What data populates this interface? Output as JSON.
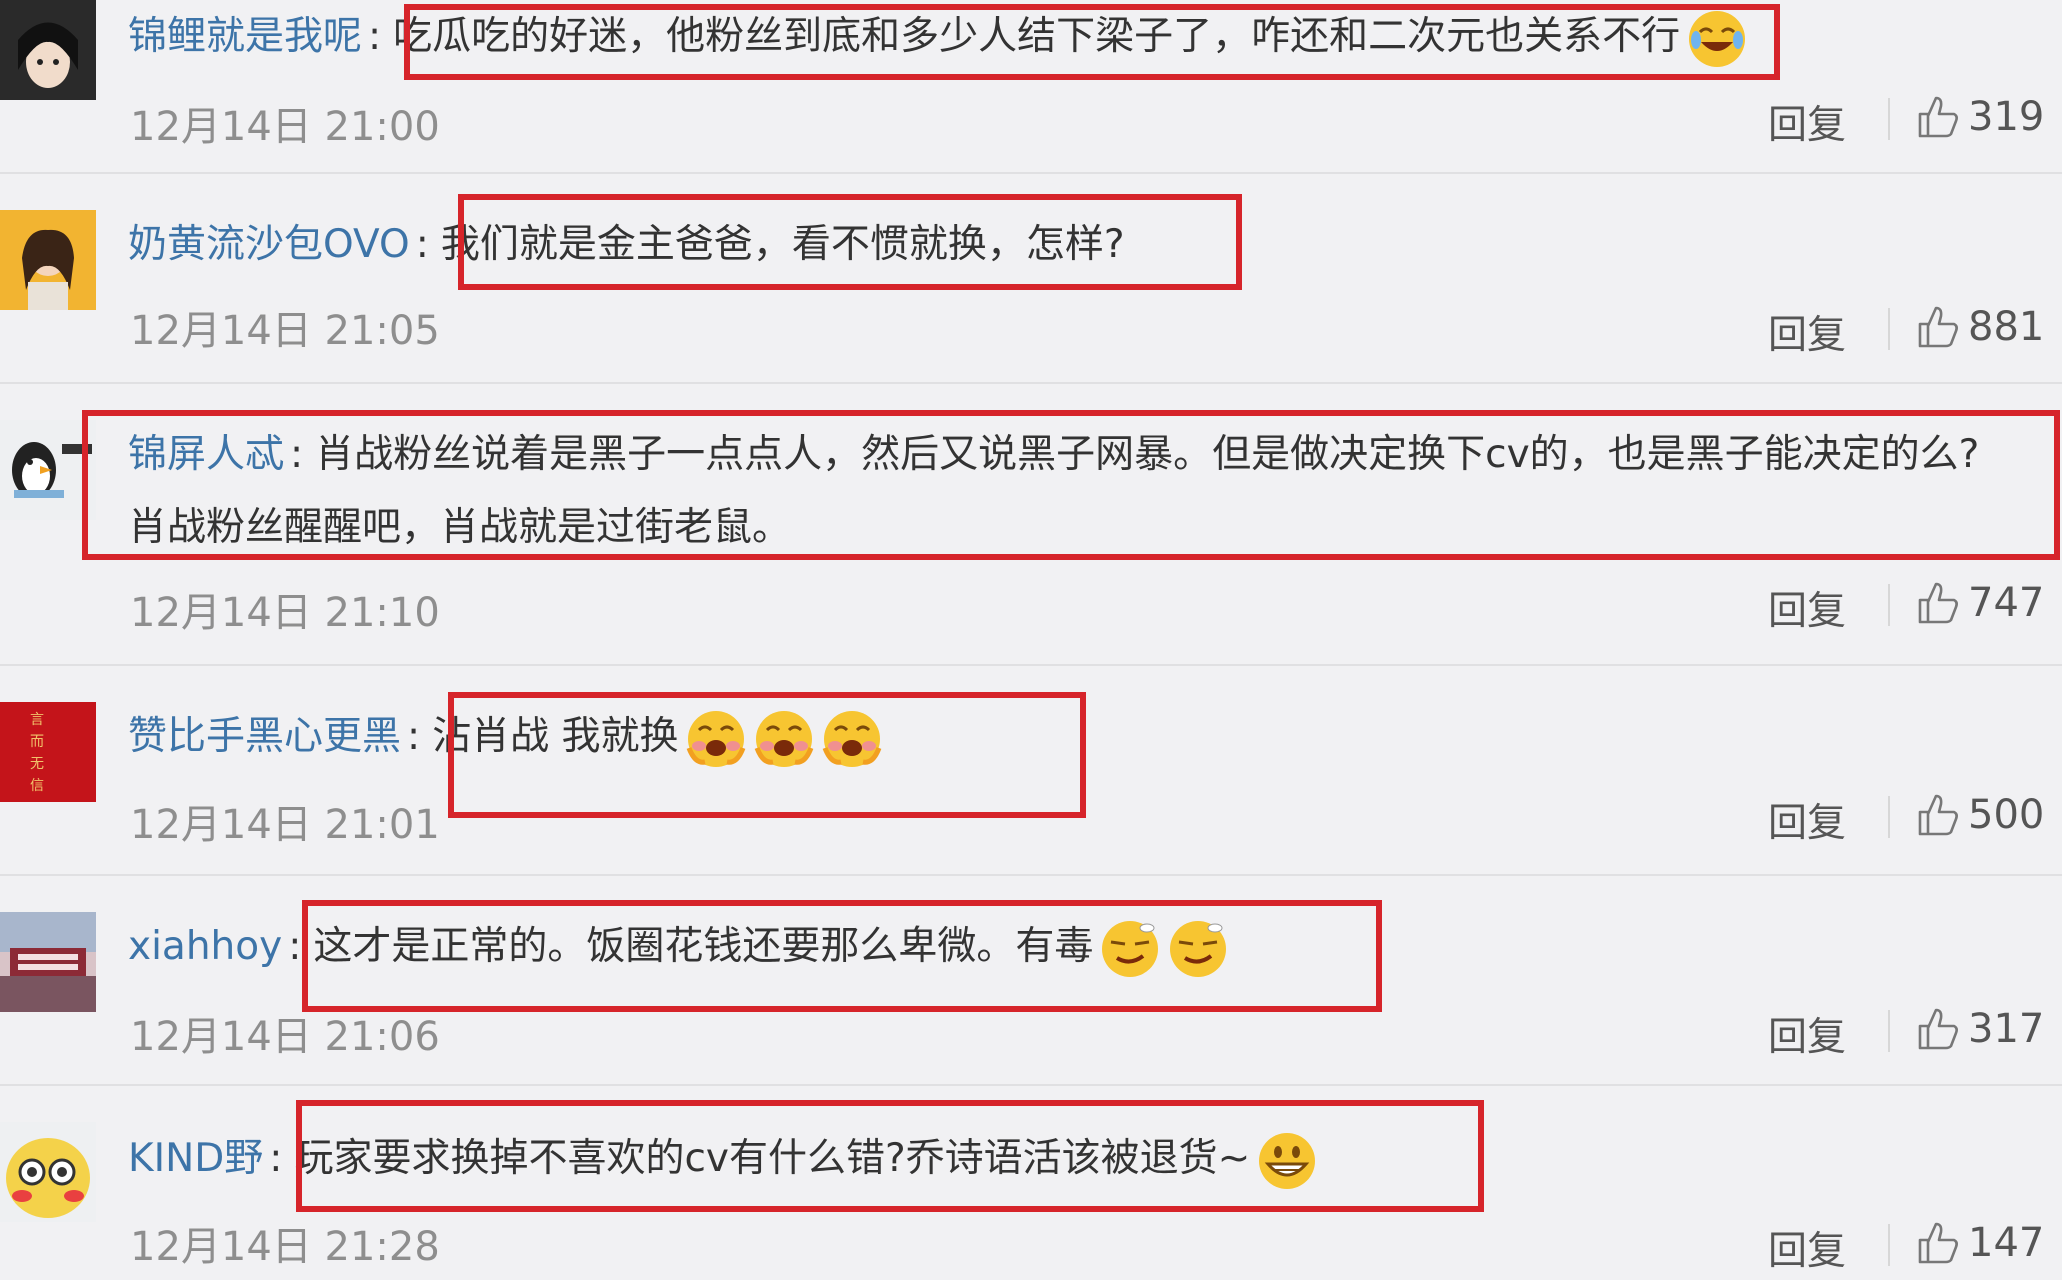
{
  "comments": [
    {
      "username": "锦鲤就是我呢",
      "text": "吃瓜吃的好迷，他粉丝到底和多少人结下梁子了，咋还和二次元也关系不行",
      "time": "12月14日 21:00",
      "reply": "回复",
      "likes": "319",
      "emoji": "laugh-cry-emoji-icon"
    },
    {
      "username": "奶黄流沙包OVO",
      "text": "我们就是金主爸爸，看不惯就换，怎样?",
      "time": "12月14日 21:05",
      "reply": "回复",
      "likes": "881"
    },
    {
      "username": "锦屏人忒",
      "text": "肖战粉丝说着是黑子一点点人，然后又说黑子网暴。但是做决定换下cv的，也是黑子能决定的么?肖战粉丝醒醒吧，肖战就是过街老鼠。",
      "time": "12月14日 21:10",
      "reply": "回复",
      "likes": "747"
    },
    {
      "username": "赞比手黑心更黑",
      "text": "沾肖战 我就换",
      "time": "12月14日 21:01",
      "reply": "回复",
      "likes": "500",
      "emoji": "laugh-emoji-icon"
    },
    {
      "username": "xiahhoy",
      "text": "这才是正常的。饭圈花钱还要那么卑微。有毒",
      "time": "12月14日 21:06",
      "reply": "回复",
      "likes": "317",
      "emoji": "smug-emoji-icon"
    },
    {
      "username": "KIND野",
      "text": "玩家要求换掉不喜欢的cv有什么错?乔诗语活该被退货~",
      "time": "12月14日 21:28",
      "reply": "回复",
      "likes": "147",
      "emoji": "grin-emoji-icon"
    }
  ],
  "colors": {
    "username": "#3d74a8",
    "highlight": "#d6242a",
    "background": "#f1f1f3"
  }
}
